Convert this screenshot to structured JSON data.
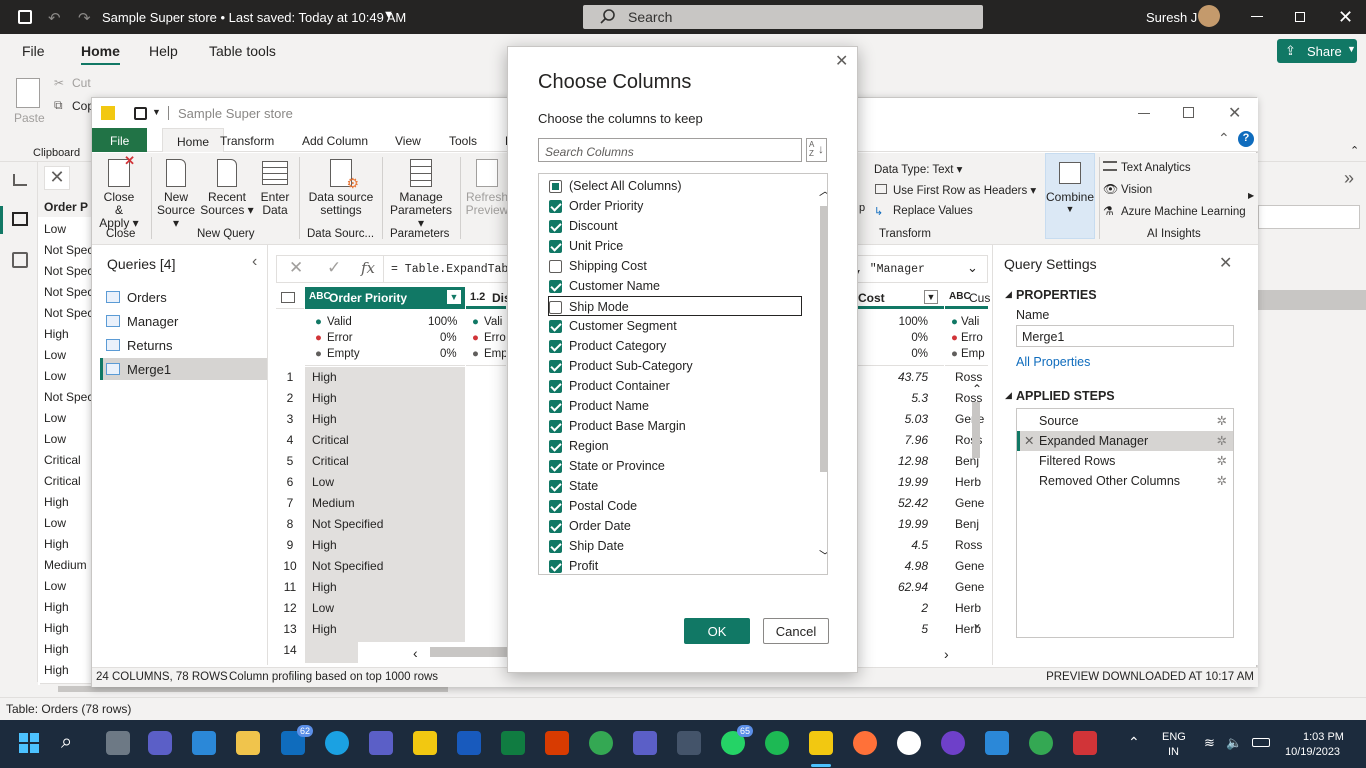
{
  "pbi": {
    "title": "Sample Super store • Last saved: Today at 10:49 AM",
    "search_placeholder": "Search",
    "user": "Suresh J",
    "menu": [
      "File",
      "Home",
      "Help",
      "Table tools"
    ],
    "share_label": "Share",
    "ribbon_labels": {
      "paste": "Paste",
      "cut": "Cut",
      "copy": "Cop",
      "clipboard": "Clipboard"
    },
    "bg_column_header": "Order P",
    "bg_column_values": [
      "Low",
      "Not Spec",
      "Not Spec",
      "Not Spec",
      "Not Spec",
      "High",
      "Low",
      "Low",
      "Not Spec",
      "Low",
      "Low",
      "Critical",
      "Critical",
      "High",
      "Low",
      "High",
      "Medium",
      "Low",
      "High",
      "High",
      "High",
      "High"
    ],
    "status": "Table: Orders (78 rows)"
  },
  "pq": {
    "title": "Sample Super store",
    "tabs": [
      "File",
      "Home",
      "Transform",
      "Add Column",
      "View",
      "Tools",
      "H"
    ],
    "ribbon": {
      "close_apply": [
        "Close &",
        "Apply"
      ],
      "new_source": [
        "New",
        "Source"
      ],
      "recent_sources": [
        "Recent",
        "Sources"
      ],
      "enter_data": [
        "Enter",
        "Data"
      ],
      "data_source_settings": [
        "Data source",
        "settings"
      ],
      "manage_parameters": [
        "Manage",
        "Parameters"
      ],
      "refresh_preview": [
        "Refresh",
        "Preview"
      ],
      "data_type": "Data Type: Text",
      "first_row_headers": "Use First Row as Headers",
      "replace_values": "Replace Values",
      "combine": "Combine",
      "text_analytics": "Text Analytics",
      "vision": "Vision",
      "azure_ml": "Azure Machine Learning",
      "groups": [
        "Close",
        "New Query",
        "Data Sourc...",
        "Parameters",
        "Transform",
        "AI Insights"
      ]
    },
    "queries_header": "Queries [4]",
    "queries": [
      "Orders",
      "Manager",
      "Returns",
      "Merge1"
    ],
    "formula": "= Table.ExpandTab",
    "formula_tail": "\", \"Manager",
    "column1": {
      "type": "ABC",
      "name": "Order Priority",
      "valid": "Valid",
      "valid_pct": "100%",
      "error": "Error",
      "error_pct": "0%",
      "empty": "Empty",
      "empty_pct": "0%"
    },
    "column2": {
      "type": "1.2",
      "name": "Disc",
      "valid": "Vali",
      "error": "Erro",
      "empty": "Emp"
    },
    "column3": {
      "name": "Cost",
      "valid_pct": "100%",
      "error_pct": "0%",
      "empty_pct": "0%"
    },
    "column4": {
      "type": "ABC",
      "name": "Cus",
      "valid": "Vali",
      "error": "Erro",
      "empty": "Emp"
    },
    "rows": [
      {
        "n": "1",
        "p": "High",
        "cost": "43.75",
        "c": "Ross"
      },
      {
        "n": "2",
        "p": "High",
        "cost": "5.3",
        "c": "Ross"
      },
      {
        "n": "3",
        "p": "High",
        "cost": "5.03",
        "c": "Gene"
      },
      {
        "n": "4",
        "p": "Critical",
        "cost": "7.96",
        "c": "Ross"
      },
      {
        "n": "5",
        "p": "Critical",
        "cost": "12.98",
        "c": "Benj"
      },
      {
        "n": "6",
        "p": "Low",
        "cost": "19.99",
        "c": "Herb"
      },
      {
        "n": "7",
        "p": "Medium",
        "cost": "52.42",
        "c": "Gene"
      },
      {
        "n": "8",
        "p": "Not Specified",
        "cost": "19.99",
        "c": "Benj"
      },
      {
        "n": "9",
        "p": "High",
        "cost": "4.5",
        "c": "Ross"
      },
      {
        "n": "10",
        "p": "Not Specified",
        "cost": "4.98",
        "c": "Gene"
      },
      {
        "n": "11",
        "p": "High",
        "cost": "62.94",
        "c": "Gene"
      },
      {
        "n": "12",
        "p": "Low",
        "cost": "2",
        "c": "Herb"
      },
      {
        "n": "13",
        "p": "High",
        "cost": "5",
        "c": "Herb"
      },
      {
        "n": "14",
        "p": "",
        "cost": "",
        "c": ""
      }
    ],
    "query_settings": "Query Settings",
    "properties": "PROPERTIES",
    "name_label": "Name",
    "name_value": "Merge1",
    "all_properties": "All Properties",
    "applied_steps": "APPLIED STEPS",
    "steps": [
      "Source",
      "Expanded Manager",
      "Filtered Rows",
      "Removed Other Columns"
    ],
    "status_left": "24 COLUMNS, 78 ROWS",
    "status_mid": "Column profiling based on top 1000 rows",
    "status_right": "PREVIEW DOWNLOADED AT 10:17 AM"
  },
  "dialog": {
    "title": "Choose Columns",
    "subtitle": "Choose the columns to keep",
    "search_placeholder": "Search Columns",
    "items": [
      {
        "label": "(Select All Columns)",
        "state": "partial"
      },
      {
        "label": "Order Priority",
        "state": "on"
      },
      {
        "label": "Discount",
        "state": "on"
      },
      {
        "label": "Unit Price",
        "state": "on"
      },
      {
        "label": "Shipping Cost",
        "state": "off"
      },
      {
        "label": "Customer Name",
        "state": "on"
      },
      {
        "label": "Ship Mode",
        "state": "off"
      },
      {
        "label": "Customer Segment",
        "state": "on"
      },
      {
        "label": "Product Category",
        "state": "on"
      },
      {
        "label": "Product Sub-Category",
        "state": "on"
      },
      {
        "label": "Product Container",
        "state": "on"
      },
      {
        "label": "Product Name",
        "state": "on"
      },
      {
        "label": "Product Base Margin",
        "state": "on"
      },
      {
        "label": "Region",
        "state": "on"
      },
      {
        "label": "State or Province",
        "state": "on"
      },
      {
        "label": "State",
        "state": "on"
      },
      {
        "label": "Postal Code",
        "state": "on"
      },
      {
        "label": "Order Date",
        "state": "on"
      },
      {
        "label": "Ship Date",
        "state": "on"
      },
      {
        "label": "Profit",
        "state": "on"
      }
    ],
    "ok": "OK",
    "cancel": "Cancel"
  },
  "taskbar": {
    "lang": "ENG",
    "region": "IN",
    "time": "1:03 PM",
    "date": "10/19/2023",
    "badge_mail": "62",
    "badge_whatsapp": "65"
  },
  "colors": {
    "accent": "#117865",
    "taskbar": "#1c2b3d",
    "title": "#252423"
  }
}
